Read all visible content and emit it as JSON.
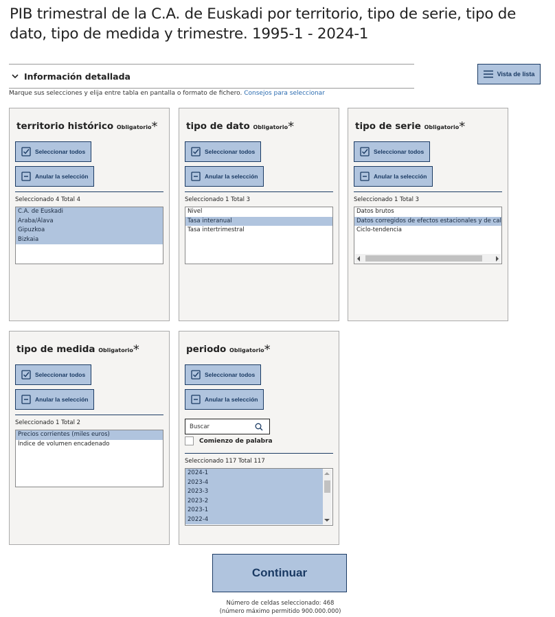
{
  "page": {
    "title": "PIB trimestral de la C.A. de Euskadi por territorio, tipo de serie, tipo de dato, tipo de medida y trimestre. 1995-1 - 2024-1"
  },
  "info_bar": {
    "label": "Información detallada",
    "icon": "chevron-down-icon"
  },
  "list_view_button": {
    "label": "Vista de lista",
    "icon": "list-icon"
  },
  "instructions": {
    "text": "Marque sus selecciones y elija entre tabla en pantalla o formato de fichero.",
    "link": "Consejos para seleccionar"
  },
  "common": {
    "required": "Obligatorio",
    "star": "*",
    "select_all": "Seleccionar todos",
    "deselect": "Anular la selección"
  },
  "panels": {
    "territorio": {
      "title": "territorio histórico",
      "count": "Seleccionado 4 Total 4",
      "options": [
        {
          "label": "C.A. de Euskadi",
          "selected": true
        },
        {
          "label": "Araba/Álava",
          "selected": true
        },
        {
          "label": "Gipuzkoa",
          "selected": true
        },
        {
          "label": "Bizkaia",
          "selected": true
        }
      ]
    },
    "tipo_dato": {
      "title": "tipo de dato",
      "count": "Seleccionado 1 Total 3",
      "options": [
        {
          "label": "Nivel",
          "selected": false
        },
        {
          "label": "Tasa interanual",
          "selected": true
        },
        {
          "label": "Tasa intertrimestral",
          "selected": false
        }
      ]
    },
    "tipo_serie": {
      "title": "tipo de serie",
      "count": "Seleccionado 1 Total 3",
      "options": [
        {
          "label": "Datos brutos",
          "selected": false
        },
        {
          "label": "Datos corregidos de efectos estacionales y de calendario",
          "selected": true
        },
        {
          "label": "Ciclo-tendencia",
          "selected": false
        }
      ]
    },
    "tipo_medida": {
      "title": "tipo de medida",
      "count": "Seleccionado 1 Total 2",
      "options": [
        {
          "label": "Precios corrientes (miles euros)",
          "selected": true
        },
        {
          "label": "Índice de volumen encadenado",
          "selected": false
        }
      ]
    },
    "periodo": {
      "title": "periodo",
      "search_placeholder": "Buscar",
      "word_start_label": "Comienzo de palabra",
      "count": "Seleccionado 117 Total 117",
      "options": [
        {
          "label": "2024-1",
          "selected": true
        },
        {
          "label": "2023-4",
          "selected": true
        },
        {
          "label": "2023-3",
          "selected": true
        },
        {
          "label": "2023-2",
          "selected": true
        },
        {
          "label": "2023-1",
          "selected": true
        },
        {
          "label": "2022-4",
          "selected": true
        }
      ]
    }
  },
  "continue_button": {
    "label": "Continuar"
  },
  "cells_info": {
    "line1": "Número de celdas seleccionado:   468",
    "line2": "(número máximo permitido 900.000.000)"
  },
  "colors": {
    "accent": "#b0c4de",
    "accent_border": "#1a3a63",
    "panel_bg": "#f5f4f2",
    "link": "#2a6bb0"
  }
}
